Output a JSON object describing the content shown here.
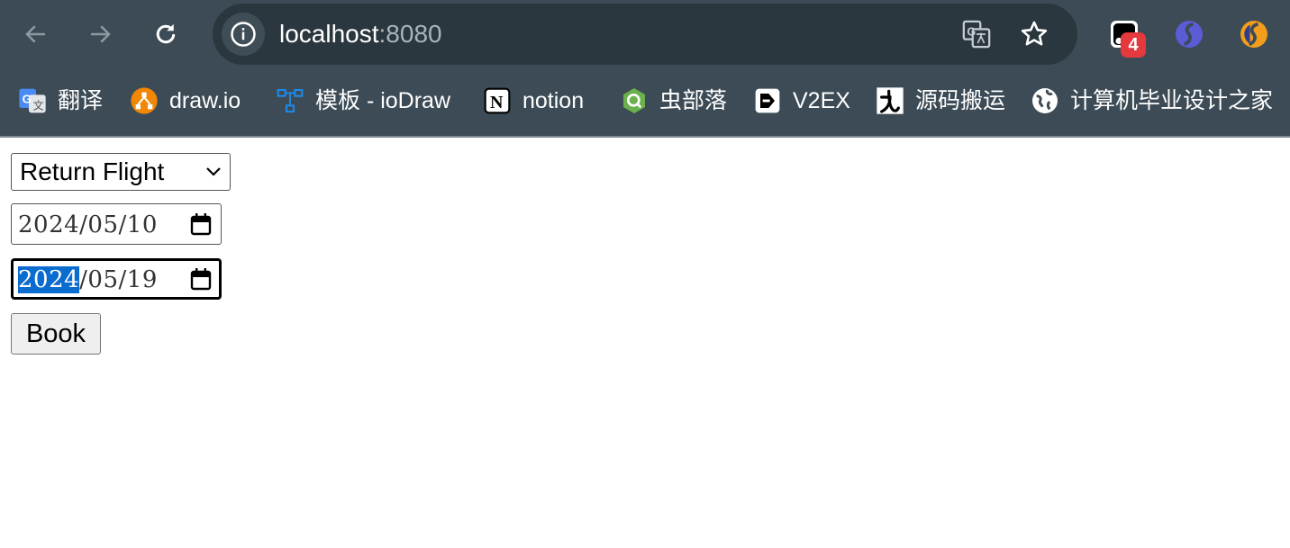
{
  "browser": {
    "url_host": "localhost",
    "url_port": ":8080",
    "extension_badge": "4",
    "bookmarks": [
      {
        "label": "翻译",
        "icon": "google-translate-icon"
      },
      {
        "label": "draw.io",
        "icon": "drawio-icon"
      },
      {
        "label": "模板 - ioDraw",
        "icon": "iodraw-icon"
      },
      {
        "label": "notion",
        "icon": "notion-icon"
      },
      {
        "label": "虫部落",
        "icon": "chongbuluo-icon"
      },
      {
        "label": "V2EX",
        "icon": "v2ex-icon"
      },
      {
        "label": "源码搬运",
        "icon": "yuanma-icon"
      },
      {
        "label": "计算机毕业设计之家",
        "icon": "globe-icon"
      }
    ],
    "colors": {
      "chrome": "#3c4b55",
      "omnibox": "#2b373f"
    }
  },
  "form": {
    "trip_type": "Return Flight",
    "departure_date": {
      "year": "2024",
      "rest": "/05/10"
    },
    "return_date": {
      "year": "2024",
      "rest": "/05/19"
    },
    "book_label": "Book",
    "selection_color": "#0b6ccf"
  }
}
